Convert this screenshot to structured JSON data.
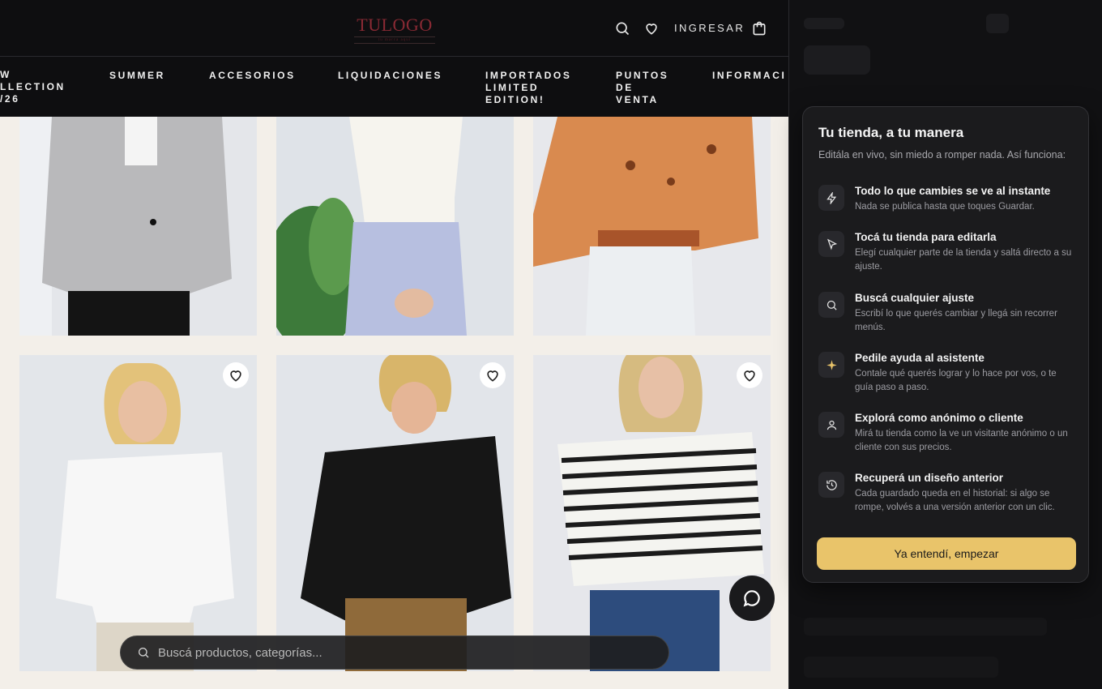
{
  "header": {
    "logo_text": "TULOGO",
    "logo_sub": "tu marca aquí",
    "login_label": "INGRESAR"
  },
  "nav": {
    "items": [
      "W\nLLECTION\n/26",
      "SUMMER",
      "ACCESORIOS",
      "LIQUIDACIONES",
      "IMPORTADOS\nLIMITED\nEDITION!",
      "PUNTOS\nDE\nVENTA",
      "INFORMACI"
    ]
  },
  "search": {
    "placeholder": "Buscá productos, categorías..."
  },
  "onboarding": {
    "title": "Tu tienda, a tu manera",
    "subtitle": "Editála en vivo, sin miedo a romper nada. Así funciona:",
    "features": [
      {
        "icon": "lightning-icon",
        "title": "Todo lo que cambies se ve al instante",
        "desc": "Nada se publica hasta que toques Guardar."
      },
      {
        "icon": "cursor-icon",
        "title": "Tocá tu tienda para editarla",
        "desc": "Elegí cualquier parte de la tienda y saltá directo a su ajuste."
      },
      {
        "icon": "search-icon",
        "title": "Buscá cualquier ajuste",
        "desc": "Escribí lo que querés cambiar y llegá sin recorrer menús."
      },
      {
        "icon": "sparkle-icon",
        "title": "Pedile ayuda al asistente",
        "desc": "Contale qué querés lograr y lo hace por vos, o te guía paso a paso."
      },
      {
        "icon": "user-icon",
        "title": "Explorá como anónimo o cliente",
        "desc": "Mirá tu tienda como la ve un visitante anónimo o un cliente con sus precios."
      },
      {
        "icon": "history-icon",
        "title": "Recuperá un diseño anterior",
        "desc": "Cada guardado queda en el historial: si algo se rompe, volvés a una versión anterior con un clic."
      }
    ],
    "cta_label": "Ya entendí, empezar"
  },
  "colors": {
    "accent": "#e9c46a",
    "header_bg": "#0e0e10",
    "logo": "#8a2a34"
  }
}
